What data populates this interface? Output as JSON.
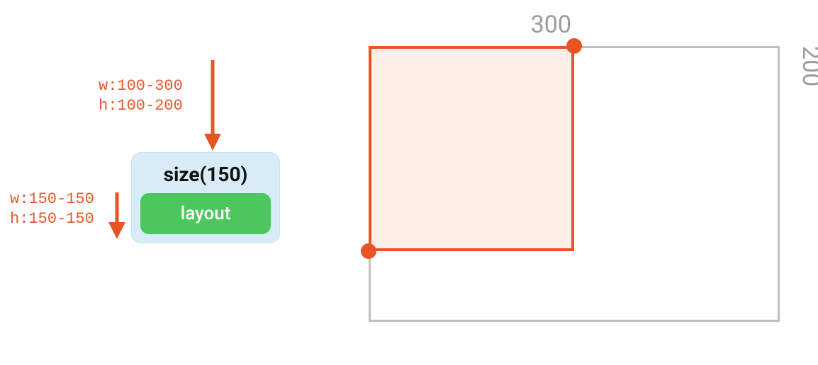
{
  "arrows": {
    "incoming": {
      "constraint_width": "w:100-300",
      "constraint_height": "h:100-200"
    },
    "outgoing": {
      "constraint_width": "w:150-150",
      "constraint_height": "h:150-150"
    }
  },
  "node": {
    "title": "size(150)",
    "child_label": "layout"
  },
  "illustration": {
    "outer_width_label": "300",
    "outer_height_label": "200"
  },
  "colors": {
    "accent": "#ea5424",
    "node_bg": "#d7ecf7",
    "child_bg": "#4cc75e",
    "dim": "#9c9c9c"
  }
}
